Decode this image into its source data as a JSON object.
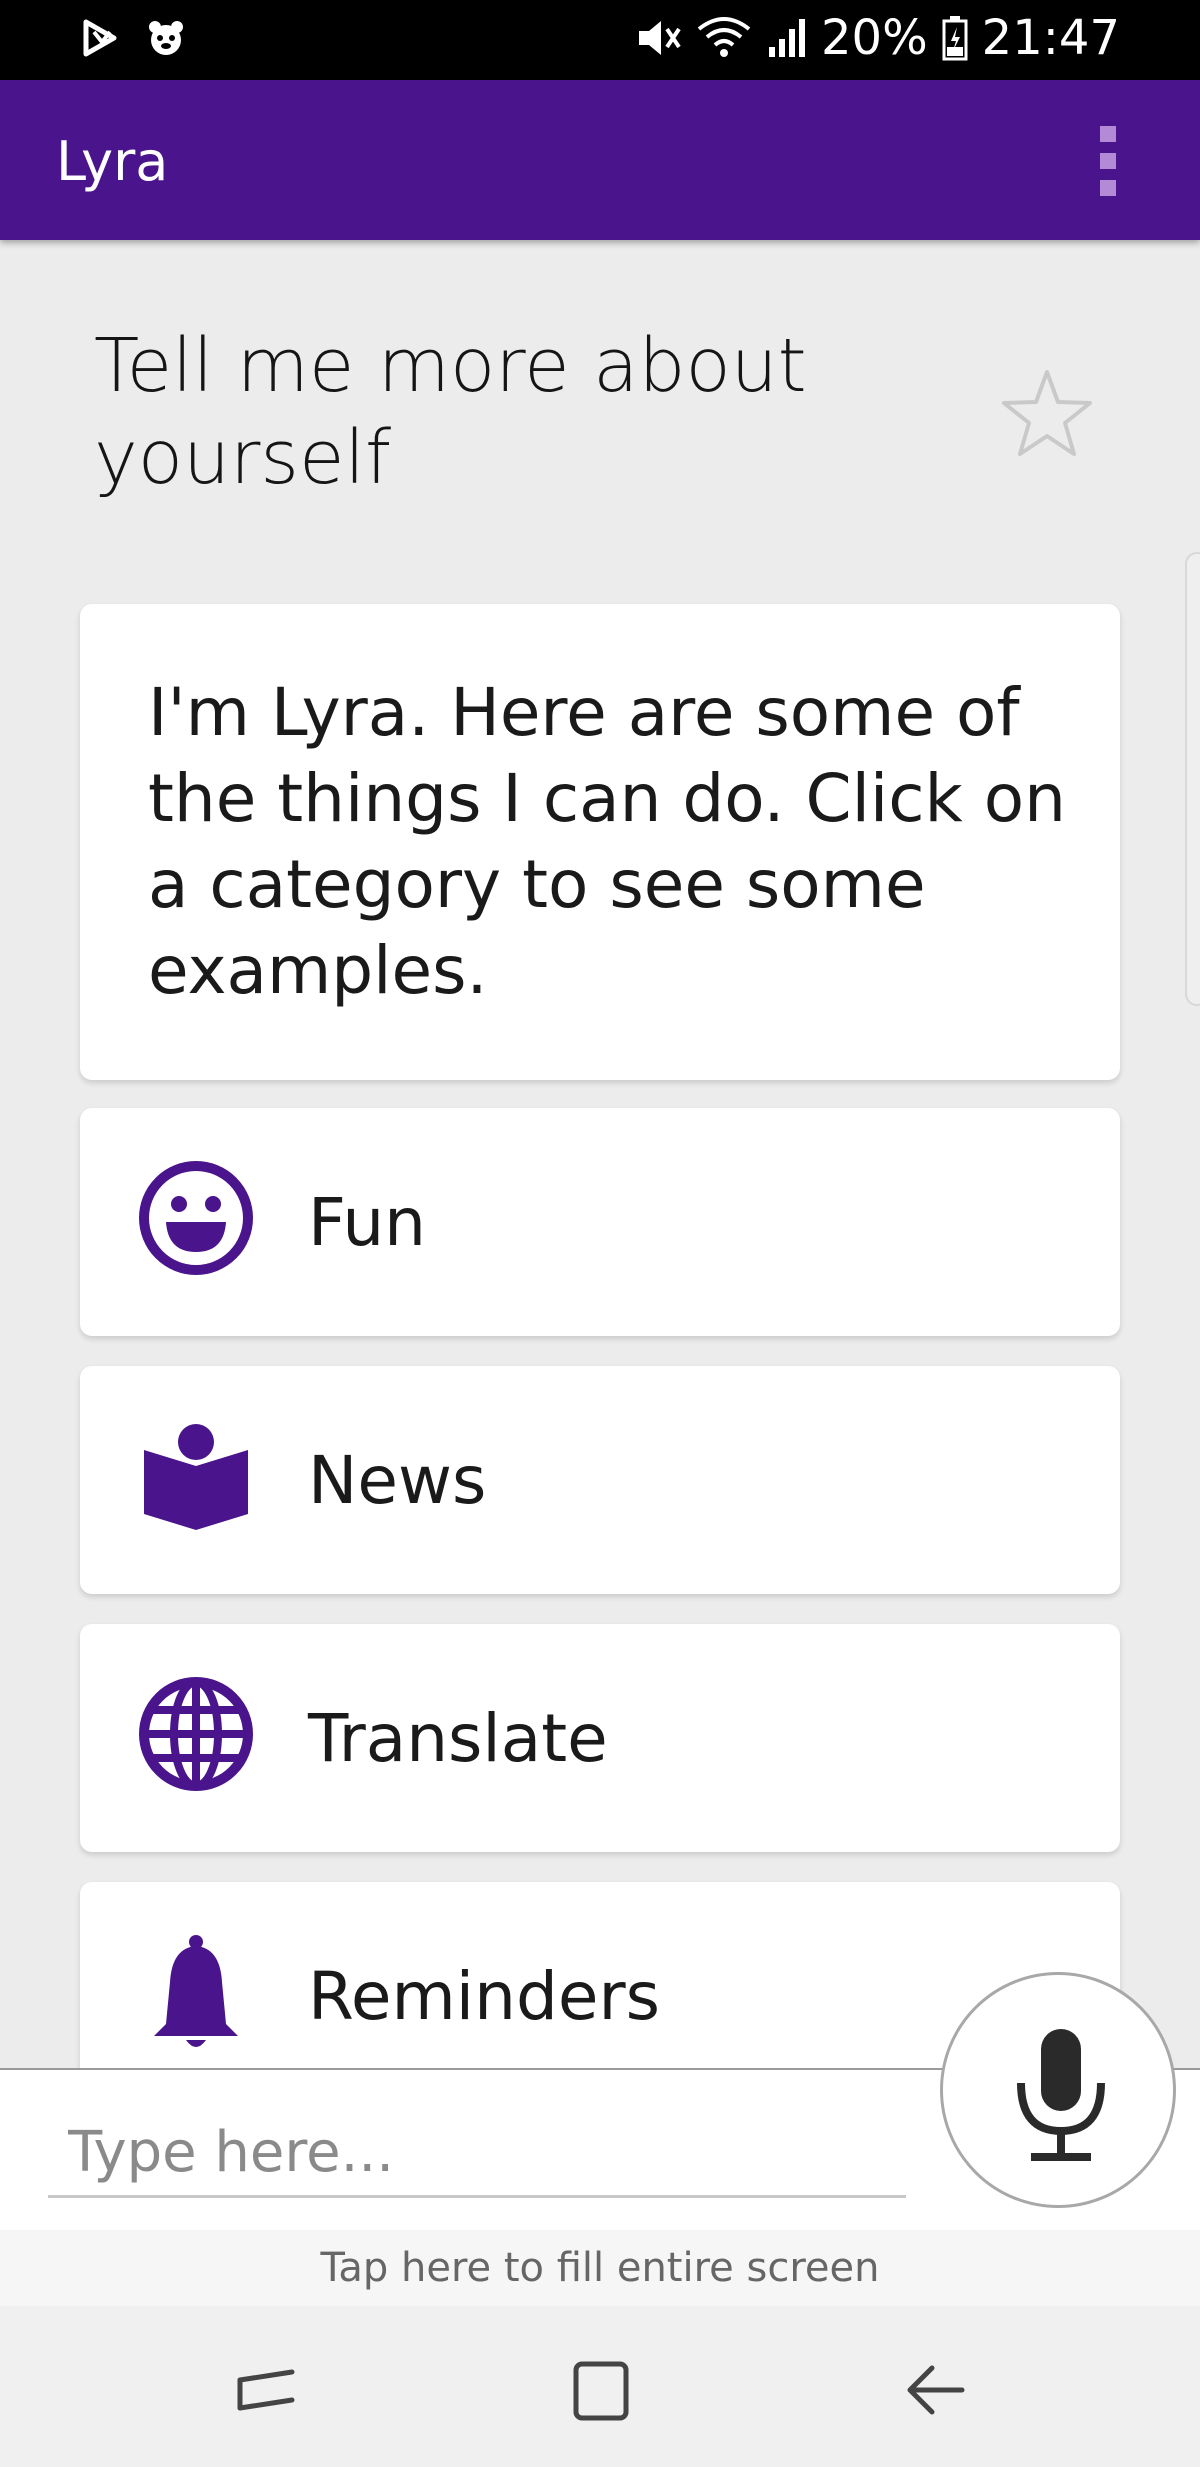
{
  "status_bar": {
    "battery": "20%",
    "time": "21:47"
  },
  "app_bar": {
    "title": "Lyra"
  },
  "question": {
    "text": "Tell me more about yourself"
  },
  "intro_card": {
    "text": "I'm Lyra. Here are some of the things I can do. Click on a category to see some examples."
  },
  "categories": [
    {
      "label": "Fun",
      "icon": "smiley-icon"
    },
    {
      "label": "News",
      "icon": "reading-icon"
    },
    {
      "label": "Translate",
      "icon": "globe-icon"
    },
    {
      "label": "Reminders",
      "icon": "bell-icon"
    }
  ],
  "input": {
    "placeholder": "Type here..."
  },
  "hint": {
    "text": "Tap here to fill entire screen"
  },
  "colors": {
    "app_bar": "#4a148c",
    "accent": "#4a148c",
    "status_bar": "#000000"
  }
}
